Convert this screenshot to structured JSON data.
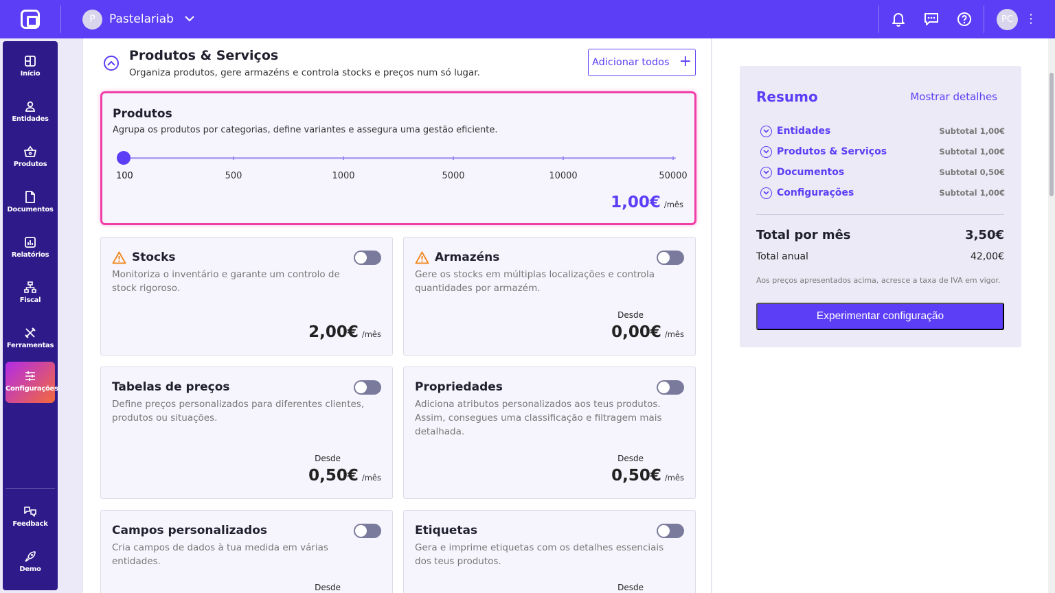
{
  "topbar": {
    "company_initial": "P",
    "company_name": "Pastelariab",
    "user_initials": "PC"
  },
  "sidebar": {
    "items": [
      {
        "label": "Início",
        "icon": "home-icon"
      },
      {
        "label": "Entidades",
        "icon": "user-icon"
      },
      {
        "label": "Produtos",
        "icon": "basket-icon"
      },
      {
        "label": "Documentos",
        "icon": "document-icon"
      },
      {
        "label": "Relatórios",
        "icon": "chart-icon"
      },
      {
        "label": "Fiscal",
        "icon": "fiscal-icon"
      },
      {
        "label": "Ferramentas",
        "icon": "tools-icon"
      },
      {
        "label": "Configurações",
        "icon": "sliders-icon",
        "active": true
      }
    ],
    "bottom": [
      {
        "label": "Feedback",
        "icon": "feedback-icon"
      },
      {
        "label": "Demo",
        "icon": "rocket-icon"
      }
    ]
  },
  "section": {
    "title": "Produtos & Serviços",
    "subtitle": "Organiza produtos, gere armazéns e controla stocks e preços num só lugar.",
    "add_all_label": "Adicionar todos"
  },
  "products_card": {
    "title": "Produtos",
    "description": "Agrupa os produtos por categorias, define variantes e assegura uma gestão eficiente.",
    "slider_steps": [
      "100",
      "500",
      "1000",
      "5000",
      "10000",
      "50000"
    ],
    "slider_selected": "100",
    "price": "1,00€",
    "unit": "/mês"
  },
  "features": [
    {
      "title": "Stocks",
      "warning": true,
      "description": "Monitoriza o inventário e garante um controlo de stock rigoroso.",
      "from_label": "",
      "price": "2,00€",
      "unit": "/mês",
      "enabled": false
    },
    {
      "title": "Armazéns",
      "warning": true,
      "description": "Gere os stocks em múltiplas localizações e controla quantidades por armazém.",
      "from_label": "Desde",
      "price": "0,00€",
      "unit": "/mês",
      "enabled": false
    },
    {
      "title": "Tabelas de preços",
      "warning": false,
      "description": "Define preços personalizados para diferentes clientes, produtos ou situações.",
      "from_label": "Desde",
      "price": "0,50€",
      "unit": "/mês",
      "enabled": false
    },
    {
      "title": "Propriedades",
      "warning": false,
      "description": "Adiciona atributos personalizados aos teus produtos. Assim, consegues uma classificação e filtragem mais detalhada.",
      "from_label": "Desde",
      "price": "0,50€",
      "unit": "/mês",
      "enabled": false
    },
    {
      "title": "Campos personalizados",
      "warning": false,
      "description": "Cria campos de dados à tua medida em várias entidades.",
      "from_label": "Desde",
      "price": "",
      "unit": "",
      "enabled": false
    },
    {
      "title": "Etiquetas",
      "warning": false,
      "description": "Gera e imprime etiquetas com os detalhes essenciais dos teus produtos.",
      "from_label": "Desde",
      "price": "",
      "unit": "",
      "enabled": false
    }
  ],
  "summary": {
    "title": "Resumo",
    "details_link": "Mostrar detalhes",
    "rows": [
      {
        "name": "Entidades",
        "subtotal": "Subtotal 1,00€"
      },
      {
        "name": "Produtos & Serviços",
        "subtotal": "Subtotal 1,00€"
      },
      {
        "name": "Documentos",
        "subtotal": "Subtotal 0,50€"
      },
      {
        "name": "Configurações",
        "subtotal": "Subtotal 1,00€"
      }
    ],
    "total_label": "Total por mês",
    "total_value": "3,50€",
    "annual_label": "Total anual",
    "annual_value": "42,00€",
    "vat_note": "Aos preços apresentados acima, acresce a taxa de IVA em vigor.",
    "cta_label": "Experimentar configuração"
  },
  "colors": {
    "accent": "#5b3ef5",
    "sidebar": "#2f1a8a",
    "highlight": "#f03ea8",
    "warning": "#f08a24"
  }
}
